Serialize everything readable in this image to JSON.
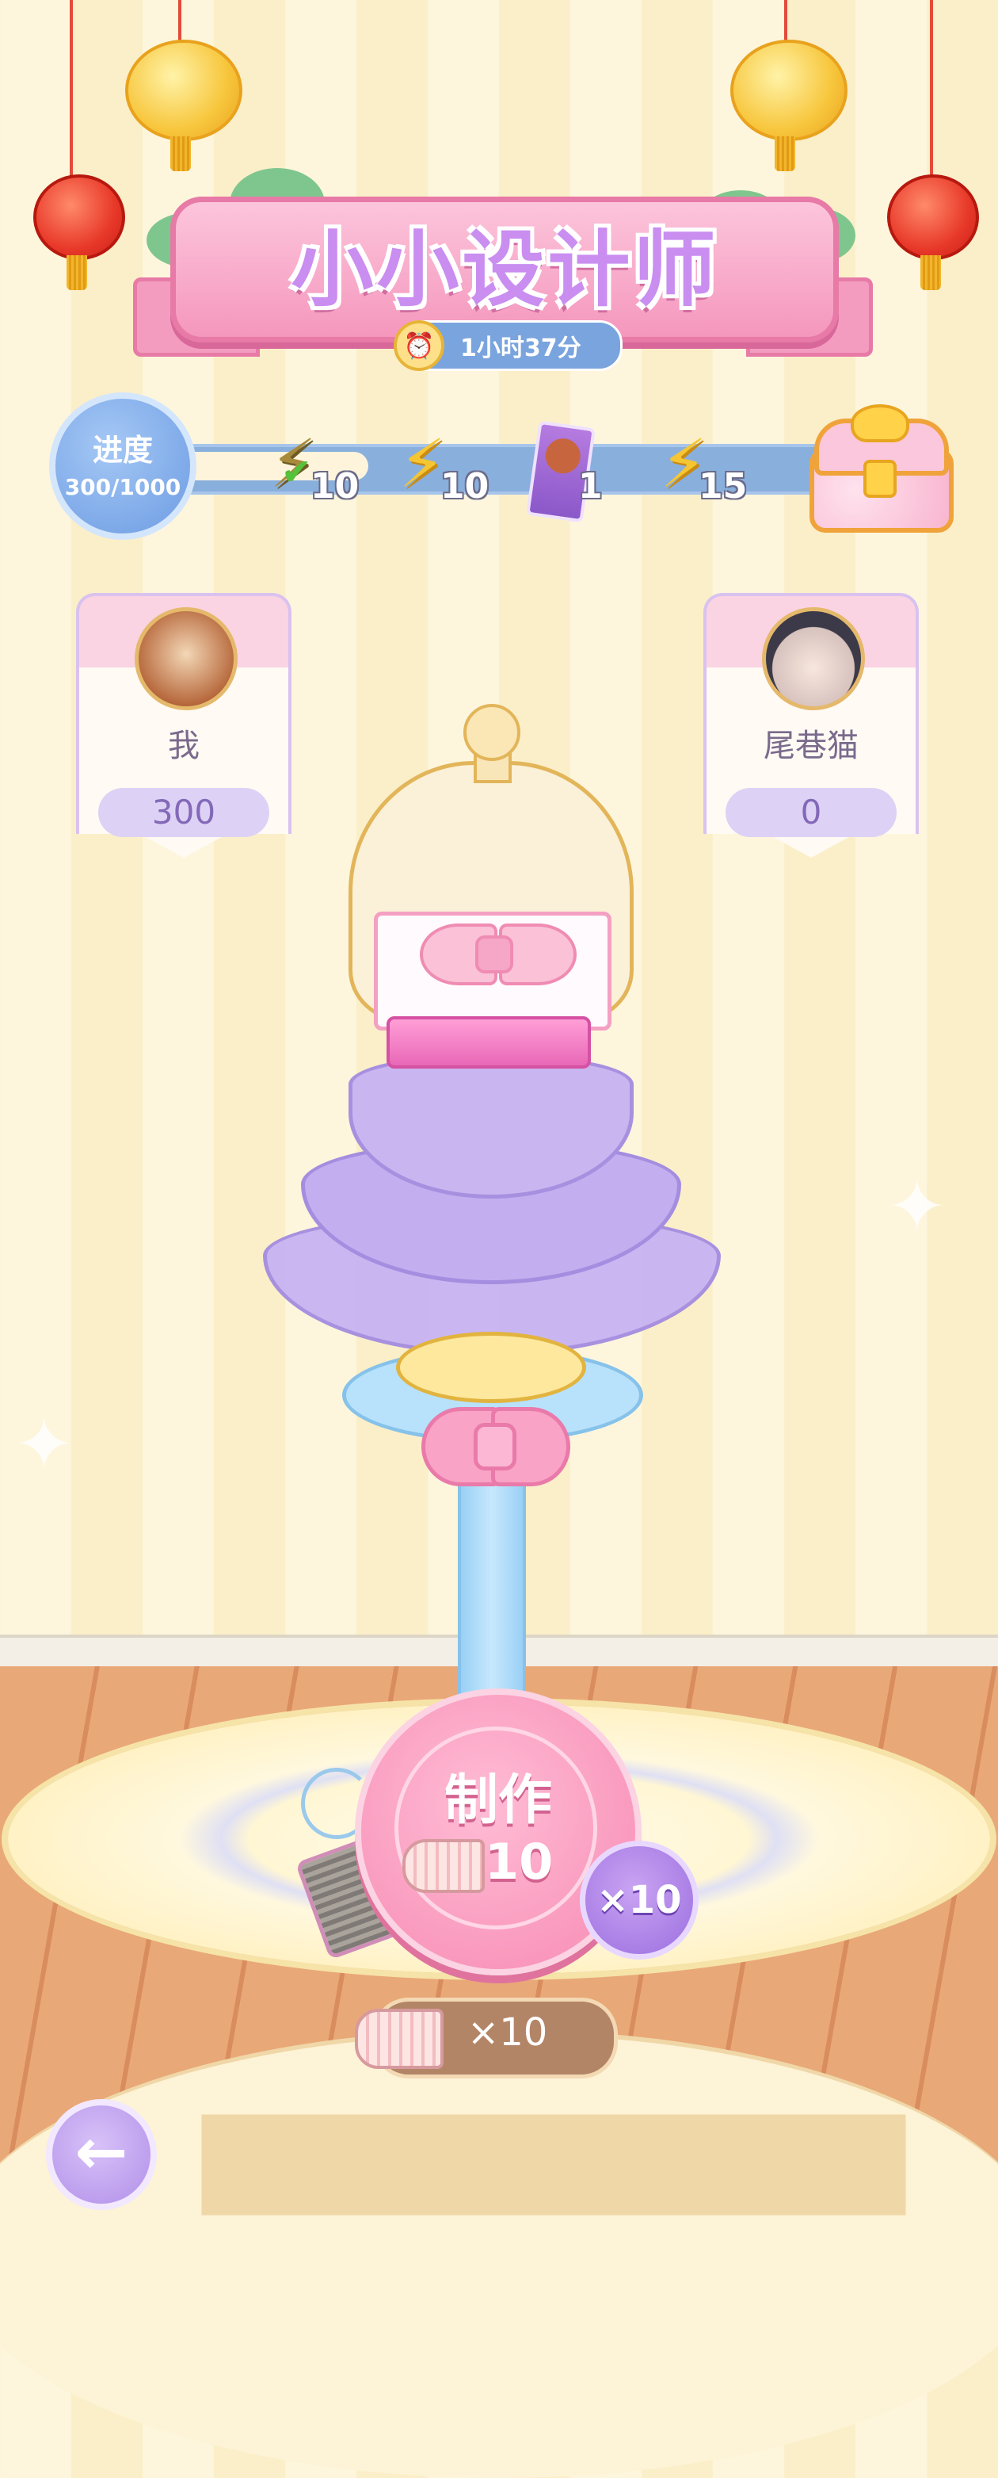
{
  "title": "小小设计师",
  "timer": {
    "label": "1小时37分",
    "icon": "alarm-clock-icon"
  },
  "progress": {
    "label": "进度",
    "value": "300/1000",
    "current": 300,
    "max": 1000,
    "rewards": [
      {
        "icon": "lightning-icon",
        "amount": "10",
        "claimed": true
      },
      {
        "icon": "lightning-icon",
        "amount": "10",
        "claimed": false
      },
      {
        "icon": "character-card-icon",
        "amount": "1",
        "claimed": false
      },
      {
        "icon": "lightning-icon",
        "amount": "15",
        "claimed": false
      }
    ],
    "final_reward_icon": "treasure-chest-icon"
  },
  "players": [
    {
      "name": "我",
      "score": "300",
      "avatar": "cat-avatar"
    },
    {
      "name": "尾巷猫",
      "score": "0",
      "avatar": "character-avatar"
    }
  ],
  "make_button": {
    "label": "制作",
    "cost": "10",
    "cost_icon": "fabric-roll-icon"
  },
  "multiplier_button": {
    "label": "×10"
  },
  "inventory": {
    "label": "×10",
    "icon": "fabric-roll-icon"
  },
  "colors": {
    "banner_pink": "#f597bd",
    "title_purple": "#c98ef0",
    "progress_blue": "#7aa4de",
    "card_lavender": "#ddd2f5",
    "make_pink": "#f78ab3",
    "skirt_purple": "#c3aef0"
  }
}
